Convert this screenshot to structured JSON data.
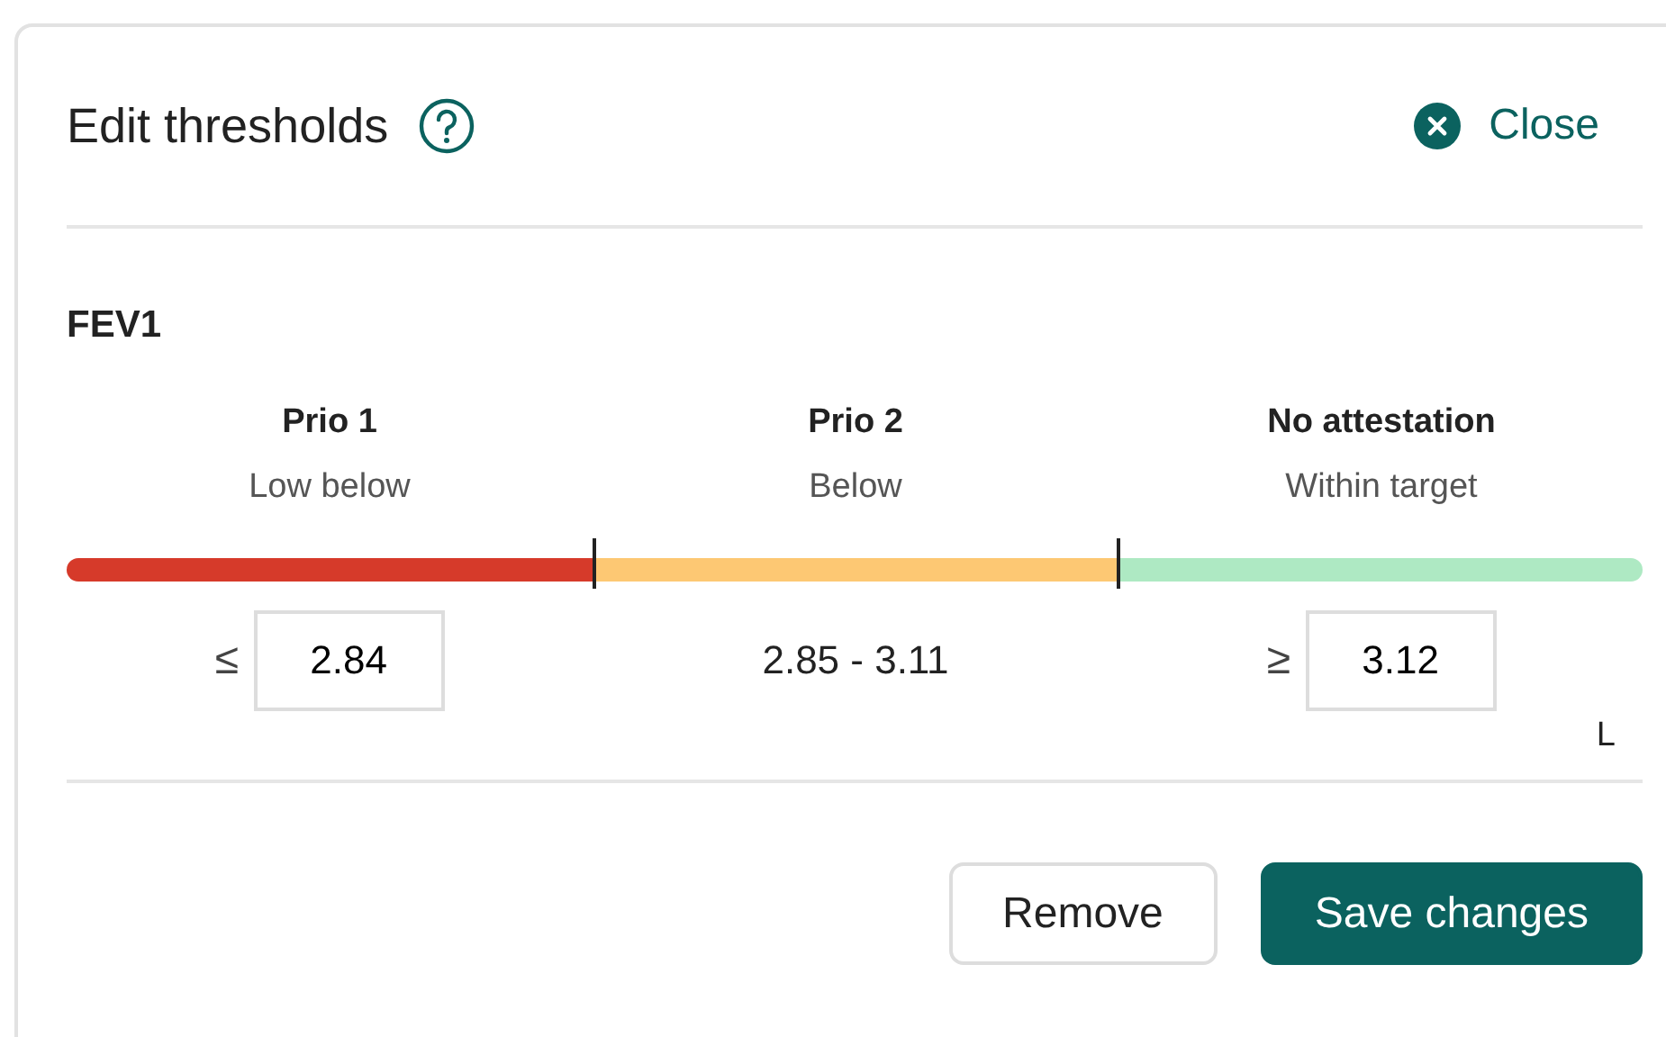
{
  "dialog": {
    "title": "Edit thresholds",
    "close_label": "Close"
  },
  "metric": {
    "name": "FEV1",
    "unit": "L",
    "zones": [
      {
        "label": "Prio 1",
        "sublabel": "Low below",
        "color": "#d63a2a",
        "kind": "input",
        "symbol": "≤",
        "value": "2.84"
      },
      {
        "label": "Prio 2",
        "sublabel": "Below",
        "color": "#fdc873",
        "kind": "range",
        "range": "2.85 - 3.11"
      },
      {
        "label": "No attestation",
        "sublabel": "Within target",
        "color": "#aee9c3",
        "kind": "input",
        "symbol": "≥",
        "value": "3.12"
      }
    ]
  },
  "buttons": [
    {
      "label": "Remove",
      "kind": "secondary"
    },
    {
      "label": "Save changes",
      "kind": "primary"
    }
  ]
}
